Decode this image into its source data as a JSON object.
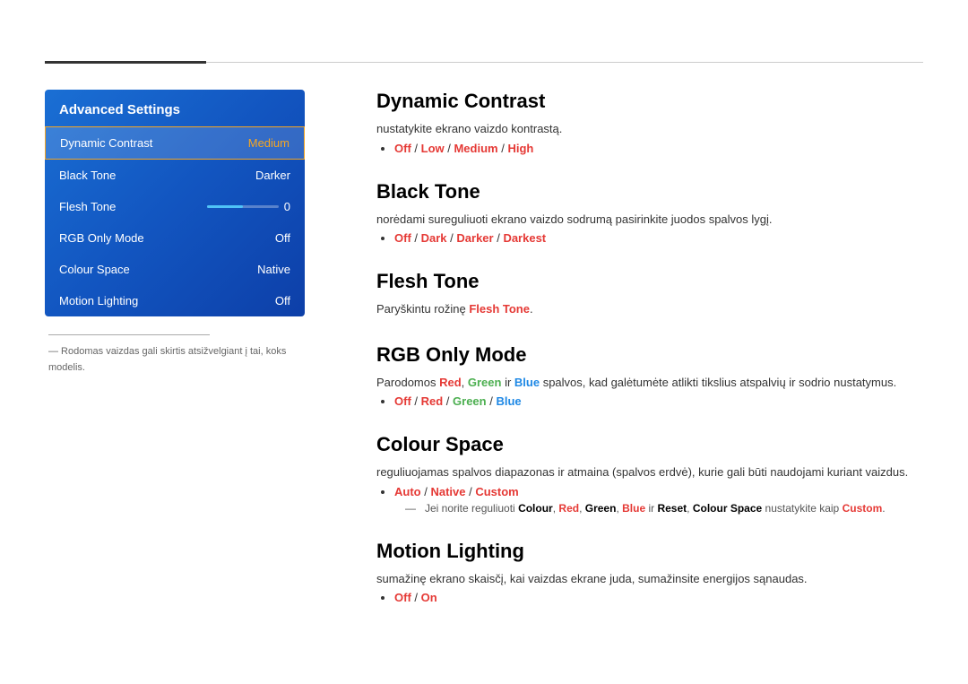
{
  "topLines": {},
  "leftPanel": {
    "title": "Advanced Settings",
    "menuItems": [
      {
        "label": "Dynamic Contrast",
        "value": "Medium",
        "active": true
      },
      {
        "label": "Black Tone",
        "value": "Darker",
        "active": false
      },
      {
        "label": "Flesh Tone",
        "value": "",
        "hasSlider": true,
        "sliderVal": "0",
        "active": false
      },
      {
        "label": "RGB Only Mode",
        "value": "Off",
        "active": false
      },
      {
        "label": "Colour Space",
        "value": "Native",
        "active": false
      },
      {
        "label": "Motion Lighting",
        "value": "Off",
        "active": false
      }
    ],
    "note": "― Rodomas vaizdas gali skirtis atsižvelgiant į tai, koks modelis."
  },
  "rightContent": {
    "sections": [
      {
        "id": "dynamic-contrast",
        "title": "Dynamic Contrast",
        "desc": "nustatykite ekrano vaizdo kontrastą.",
        "optionsHtml": true
      },
      {
        "id": "black-tone",
        "title": "Black Tone",
        "desc": "norėdami sureguliuoti ekrano vaizdo sodrumą pasirinkite juodos spalvos lygį.",
        "optionsHtml": true
      },
      {
        "id": "flesh-tone",
        "title": "Flesh Tone",
        "desc": "Paryškintu rožinę Flesh Tone.",
        "optionsHtml": true
      },
      {
        "id": "rgb-only-mode",
        "title": "RGB Only Mode",
        "desc": "Parodomos Red, Green ir Blue spalvos, kad galėtumėte atlikti tikslius atspalvių ir sodrio nustatymus.",
        "optionsHtml": true
      },
      {
        "id": "colour-space",
        "title": "Colour Space",
        "desc": "reguliuojamas spalvos diapazonas ir atmaina (spalvos erdvė), kurie gali būti naudojami kuriant vaizdus.",
        "optionsHtml": true
      },
      {
        "id": "motion-lighting",
        "title": "Motion Lighting",
        "desc": "sumažinę ekrano skaisčį, kai vaizdas ekrane juda, sumažinsite energijos sąnaudas.",
        "optionsHtml": true
      }
    ]
  }
}
